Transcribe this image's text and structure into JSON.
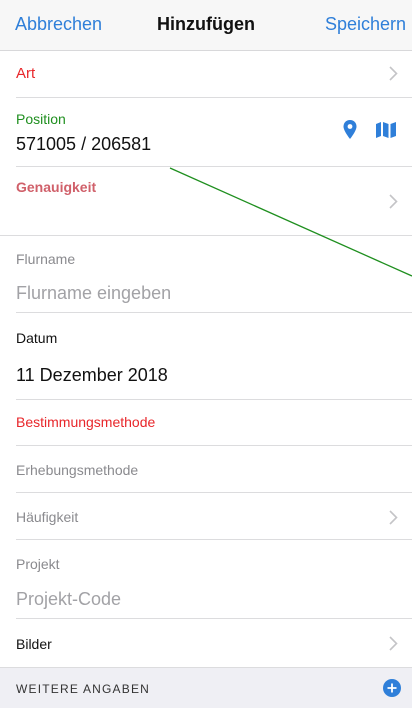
{
  "nav": {
    "cancel": "Abbrechen",
    "title": "Hinzufügen",
    "save": "Speichern"
  },
  "form": {
    "art_label": "Art",
    "position_label": "Position",
    "position_value": "571005 / 206581",
    "genauigkeit_label": "Genauigkeit",
    "flurname_label": "Flurname",
    "flurname_placeholder": "Flurname eingeben",
    "datum_label": "Datum",
    "datum_value": "11 Dezember 2018",
    "bestimmungsmethode_label": "Bestimmungsmethode",
    "erhebungsmethode_label": "Erhebungsmethode",
    "haeufigkeit_label": "Häufigkeit",
    "projekt_label": "Projekt",
    "projekt_placeholder": "Projekt-Code",
    "bilder_label": "Bilder",
    "weitere_angaben": "WEITERE ANGABEN"
  },
  "icons": {
    "location": "location-pin-icon",
    "map": "map-icon",
    "chevron": "chevron-right-icon",
    "add": "plus-circle-icon"
  },
  "colors": {
    "accent": "#2f7fd9",
    "required": "#e8262a",
    "valid": "#1f8f1f",
    "warning": "#d0606a",
    "annotation_line": "#1f8f1f"
  }
}
